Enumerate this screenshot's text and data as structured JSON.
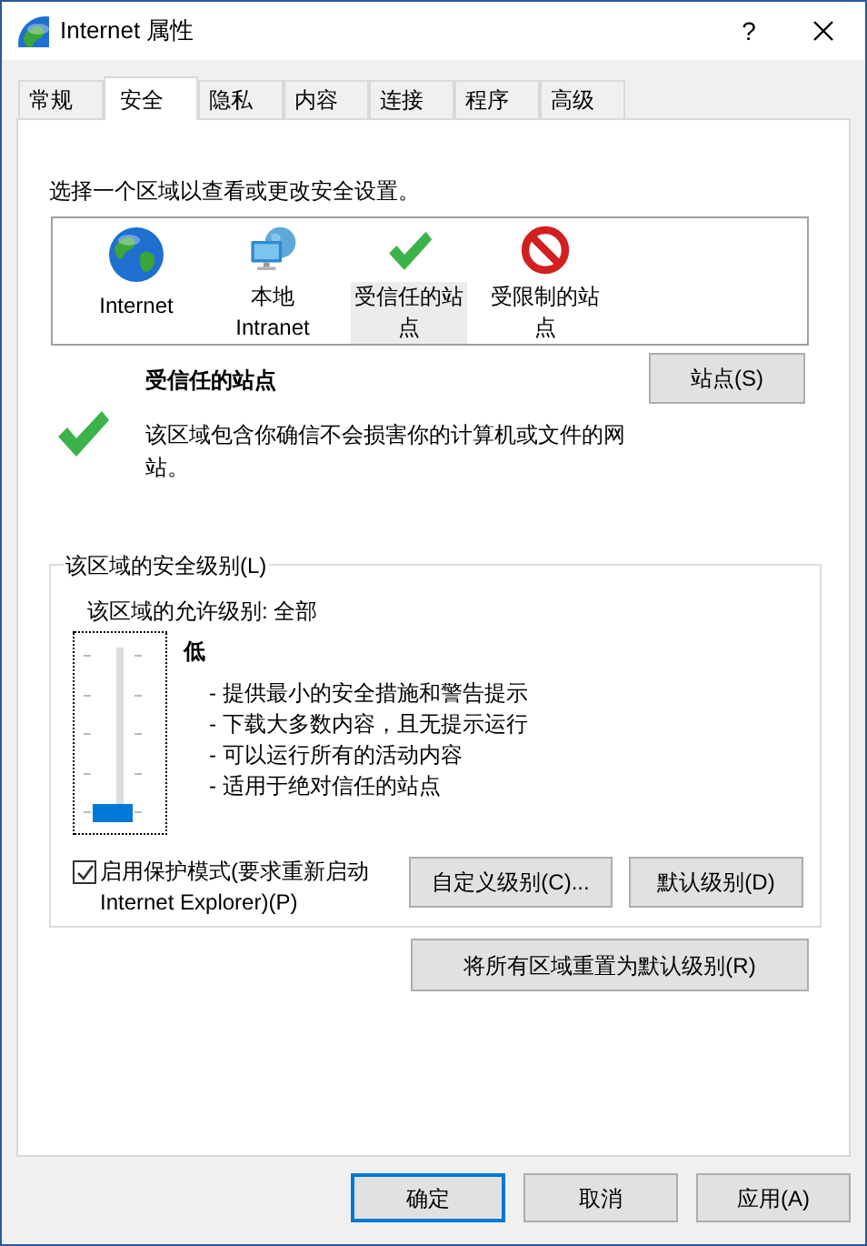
{
  "window": {
    "title": "Internet 属性",
    "help": "?"
  },
  "tabs": [
    {
      "label": "常规",
      "selected": false
    },
    {
      "label": "安全",
      "selected": true
    },
    {
      "label": "隐私",
      "selected": false
    },
    {
      "label": "内容",
      "selected": false
    },
    {
      "label": "连接",
      "selected": false
    },
    {
      "label": "程序",
      "selected": false
    },
    {
      "label": "高级",
      "selected": false
    }
  ],
  "zone_prompt": "选择一个区域以查看或更改安全设置。",
  "zones": [
    {
      "label": "Internet",
      "kind": "globe",
      "selected": false
    },
    {
      "label": "本地 Intranet",
      "kind": "intranet",
      "selected": false
    },
    {
      "label": "受信任的站点",
      "kind": "trusted",
      "selected": true
    },
    {
      "label": "受限制的站点",
      "kind": "restricted",
      "selected": false
    }
  ],
  "zone_info": {
    "kind": "trusted",
    "title": "受信任的站点",
    "description": "该区域包含你确信不会损害你的计算机或文件的网站。",
    "sites_button": "站点(S)"
  },
  "security_level": {
    "group_label": "该区域的安全级别(L)",
    "allowed_levels": "该区域的允许级别: 全部",
    "slider": {
      "level": 0
    },
    "level_name": "低",
    "bullets": [
      "- 提供最小的安全措施和警告提示",
      "- 下载大多数内容，且无提示运行",
      "- 可以运行所有的活动内容",
      "- 适用于绝对信任的站点"
    ],
    "protected_mode": {
      "label": "启用保护模式(要求重新启动 Internet Explorer)(P)",
      "checked": true
    },
    "custom_button": "自定义级别(C)...",
    "default_button": "默认级别(D)"
  },
  "reset_all_button": "将所有区域重置为默认级别(R)",
  "buttons": [
    {
      "label": "确定",
      "default": true
    },
    {
      "label": "取消",
      "default": false
    },
    {
      "label": "应用(A)",
      "default": false
    }
  ]
}
